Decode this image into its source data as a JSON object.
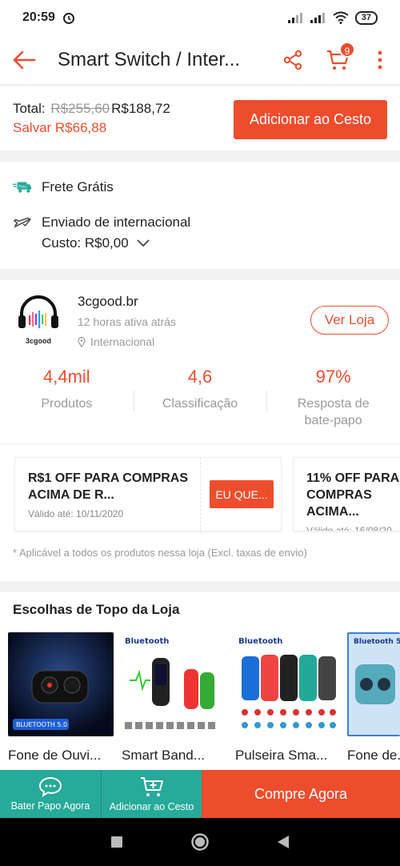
{
  "status_bar": {
    "time": "20:59",
    "battery": "37"
  },
  "app_bar": {
    "title": "Smart Switch / Inter...",
    "cart_count": "9"
  },
  "total_bar": {
    "total_label": "Total:",
    "old_price": "R$255,60",
    "price": "R$188,72",
    "save_text": "Salvar R$66,88",
    "add_button": "Adicionar ao Cesto"
  },
  "shipping": {
    "free_shipping": "Frete Grátis",
    "sent_from_prefix": "Enviado de",
    "sent_from_place": "internacional",
    "cost_label": "Custo: R$0,00"
  },
  "shop": {
    "logo_text": "3cgood",
    "name": "3cgood.br",
    "active": "12 horas ativa atrás",
    "location": "Internacional",
    "view_button": "Ver Loja",
    "stats": [
      {
        "value": "4,4mil",
        "label": "Produtos"
      },
      {
        "value": "4,6",
        "label": "Classificação"
      },
      {
        "value": "97%",
        "label": "Resposta de bate-papo"
      }
    ]
  },
  "vouchers": {
    "items": [
      {
        "title": "R$1 OFF PARA COMPRAS ACIMA DE R...",
        "valid": "Válido até: 10/11/2020",
        "claim": "EU QUE..."
      },
      {
        "title": "11% OFF PARA COMPRAS ACIMA...",
        "valid": "Válido até: 16/08/20..."
      }
    ],
    "note": "* Aplicável a todos os produtos nessa loja (Excl. taxas de envio)"
  },
  "top_picks": {
    "title": "Escolhas de Topo da Loja",
    "items": [
      {
        "name": "Fone de Ouvi...",
        "badge": "BLUETOOTH 5.0"
      },
      {
        "name": "Smart Band...",
        "badge": "Bluetooth"
      },
      {
        "name": "Pulseira Sma...",
        "badge": "Bluetooth"
      },
      {
        "name": "Fone de...",
        "badge": "Bluetooth 5"
      }
    ]
  },
  "bottom_bar": {
    "chat": "Bater Papo Agora",
    "add": "Adicionar ao Cesto",
    "buy": "Compre Agora"
  },
  "colors": {
    "accent": "#ee4d2d",
    "teal": "#26aa99"
  }
}
